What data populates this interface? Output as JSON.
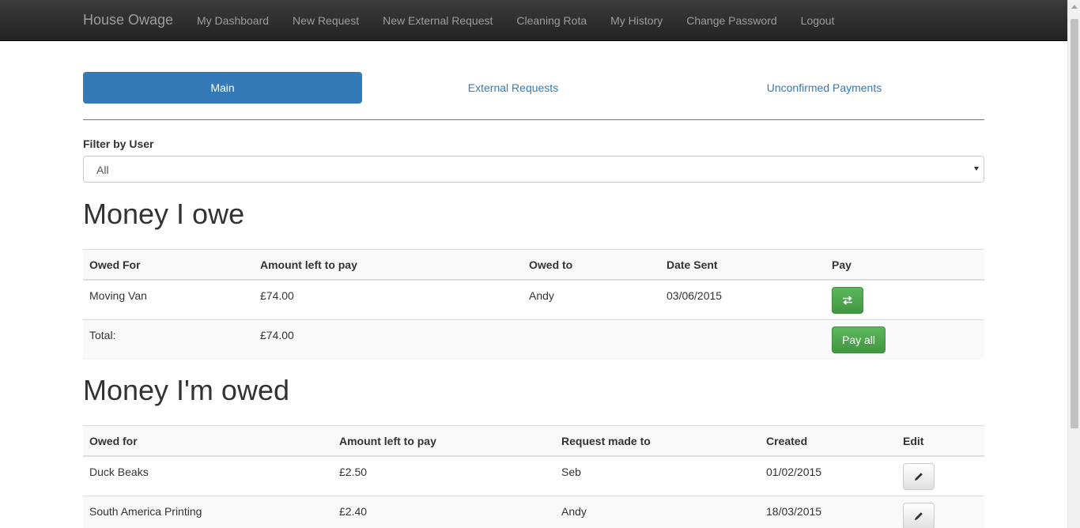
{
  "navbar": {
    "brand": "House Owage",
    "links": [
      "My Dashboard",
      "New Request",
      "New External Request",
      "Cleaning Rota",
      "My History",
      "Change Password",
      "Logout"
    ]
  },
  "tabs": {
    "main": "Main",
    "external": "External Requests",
    "unconfirmed": "Unconfirmed Payments"
  },
  "filter": {
    "label": "Filter by User",
    "selected": "All"
  },
  "owe": {
    "heading": "Money I owe",
    "headers": [
      "Owed For",
      "Amount left to pay",
      "Owed to",
      "Date Sent",
      "Pay"
    ],
    "rows": [
      {
        "owed_for": "Moving Van",
        "amount": "£74.00",
        "owed_to": "Andy",
        "date": "03/06/2015"
      }
    ],
    "total_label": "Total:",
    "total_amount": "£74.00",
    "pay_all_label": "Pay all",
    "pay_icon": "transfer-icon"
  },
  "owed": {
    "heading": "Money I'm owed",
    "headers": [
      "Owed for",
      "Amount left to pay",
      "Request made to",
      "Created",
      "Edit"
    ],
    "rows": [
      {
        "owed_for": "Duck Beaks",
        "amount": "£2.50",
        "made_to": "Seb",
        "created": "01/02/2015"
      },
      {
        "owed_for": "South America Printing",
        "amount": "£2.40",
        "made_to": "Andy",
        "created": "18/03/2015"
      }
    ],
    "edit_icon": "pencil-icon"
  },
  "colors": {
    "primary": "#337ab7",
    "success": "#5cb85c",
    "navbar": "#222222"
  }
}
